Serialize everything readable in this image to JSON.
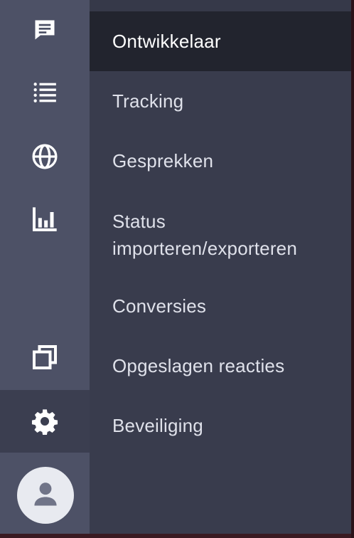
{
  "rail": {
    "items": [
      {
        "icon": "chat-icon"
      },
      {
        "icon": "list-icon"
      },
      {
        "icon": "globe-icon"
      },
      {
        "icon": "bar-chart-icon"
      },
      {
        "icon": "copy-icon"
      },
      {
        "icon": "settings-gear-icon",
        "active": true
      }
    ],
    "avatar": {
      "icon": "user-icon"
    }
  },
  "settings_menu": {
    "items": [
      {
        "label": "Ontwikkelaar",
        "active": true
      },
      {
        "label": "Tracking"
      },
      {
        "label": "Gesprekken"
      },
      {
        "label": "Status importeren/exporteren"
      },
      {
        "label": "Conversies"
      },
      {
        "label": "Opgeslagen reacties"
      },
      {
        "label": "Beveiliging"
      }
    ]
  },
  "colors": {
    "rail_bg": "#4d5166",
    "rail_active_bg": "#3b3e50",
    "panel_bg": "#393c4d",
    "menu_active_bg": "#22242e",
    "text": "#dfe1ea",
    "avatar_bg": "#e8eaf0"
  }
}
